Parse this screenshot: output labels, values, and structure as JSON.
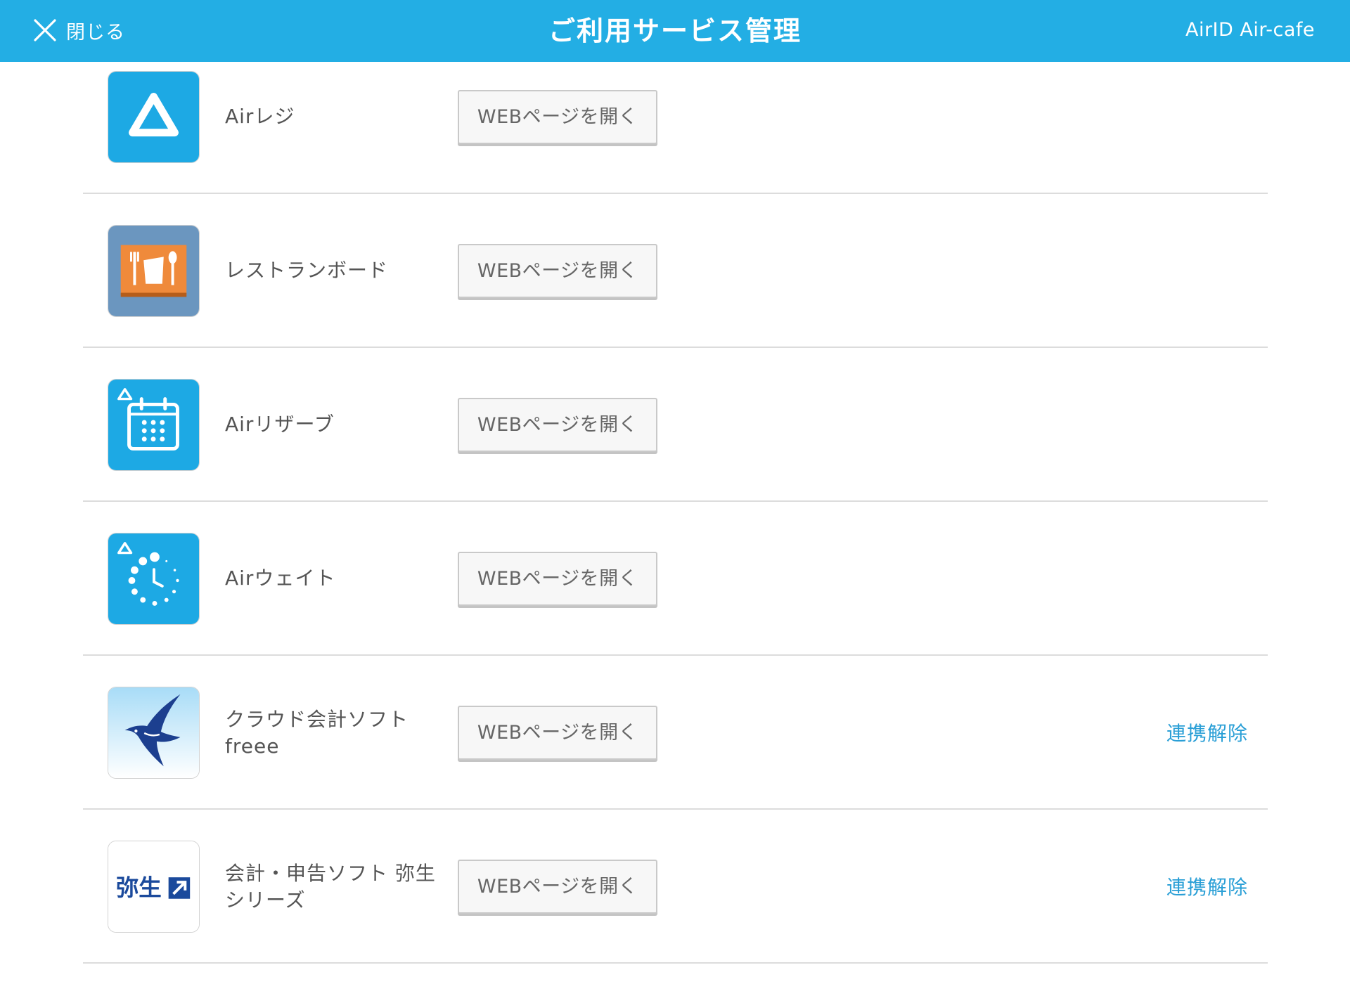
{
  "header": {
    "close_label": "閉じる",
    "title": "ご利用サービス管理",
    "account": "AirID Air-cafe",
    "background_color": "#23aee4"
  },
  "services": [
    {
      "name_line1": "Airレジ",
      "button_label": "WEBページを開く",
      "icon": "air-regi-icon"
    },
    {
      "name_line1": "レストランボード",
      "button_label": "WEBページを開く",
      "icon": "restaurant-board-icon"
    },
    {
      "name_line1": "Airリザーブ",
      "button_label": "WEBページを開く",
      "icon": "air-reserve-icon"
    },
    {
      "name_line1": "Airウェイト",
      "button_label": "WEBページを開く",
      "icon": "air-wait-icon"
    },
    {
      "name_line1": "クラウド会計ソフト",
      "name_line2": "freee",
      "button_label": "WEBページを開く",
      "unlink_label": "連携解除",
      "icon": "freee-icon"
    },
    {
      "name_line1": "会計・申告ソフト 弥生",
      "name_line2": "シリーズ",
      "button_label": "WEBページを開く",
      "unlink_label": "連携解除",
      "icon": "yayoi-icon",
      "icon_text": "弥生"
    }
  ]
}
